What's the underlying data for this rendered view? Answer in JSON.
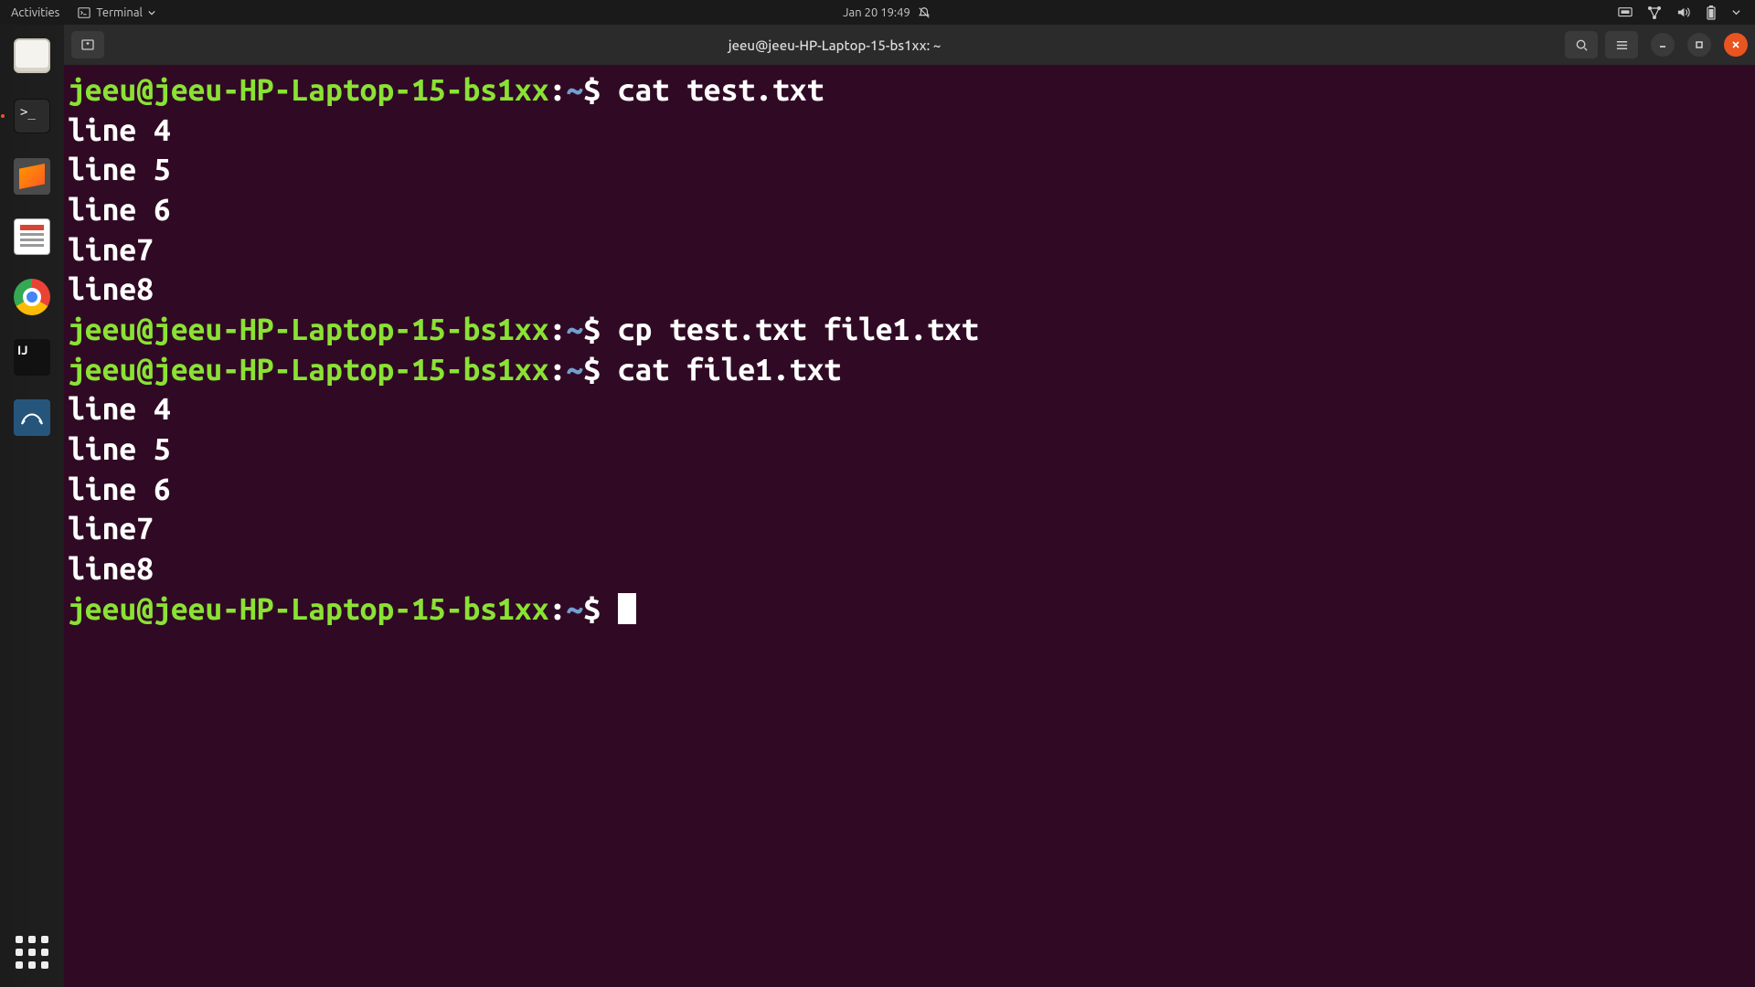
{
  "topbar": {
    "activities": "Activities",
    "app_name": "Terminal",
    "datetime": "Jan 20  19:49"
  },
  "dock": {
    "items": [
      "files",
      "terminal",
      "sublime",
      "evince",
      "chrome",
      "intellij",
      "workbench"
    ]
  },
  "window": {
    "title": "jeeu@jeeu-HP-Laptop-15-bs1xx: ~"
  },
  "prompt": {
    "user_host": "jeeu@jeeu-HP-Laptop-15-bs1xx",
    "sep": ":",
    "path": "~",
    "sigil": "$ "
  },
  "session": [
    {
      "type": "cmd",
      "text": "cat test.txt"
    },
    {
      "type": "out",
      "text": "line 4"
    },
    {
      "type": "out",
      "text": "line 5"
    },
    {
      "type": "out",
      "text": "line 6"
    },
    {
      "type": "out",
      "text": "line7"
    },
    {
      "type": "out",
      "text": "line8"
    },
    {
      "type": "cmd",
      "text": "cp test.txt file1.txt"
    },
    {
      "type": "cmd",
      "text": "cat file1.txt"
    },
    {
      "type": "out",
      "text": "line 4"
    },
    {
      "type": "out",
      "text": "line 5"
    },
    {
      "type": "out",
      "text": "line 6"
    },
    {
      "type": "out",
      "text": "line7"
    },
    {
      "type": "out",
      "text": "line8"
    },
    {
      "type": "cursor"
    }
  ]
}
